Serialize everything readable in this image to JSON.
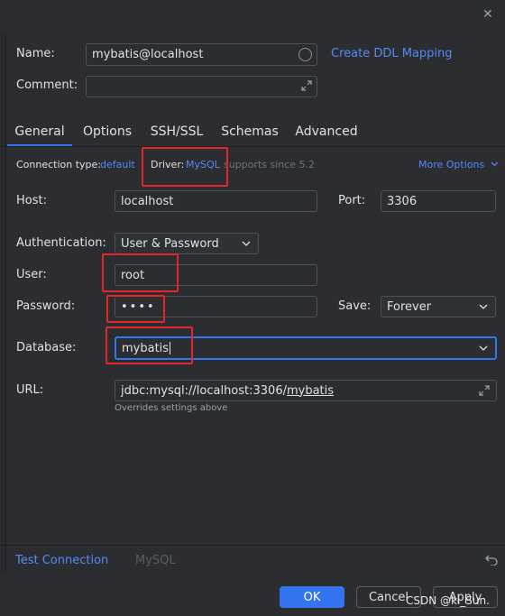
{
  "window": {
    "close_glyph": "✕"
  },
  "name": {
    "label": "Name:",
    "value": "mybatis@localhost",
    "create_ddl": "Create DDL Mapping"
  },
  "comment": {
    "label": "Comment:",
    "value": ""
  },
  "tabs": [
    {
      "label": "General"
    },
    {
      "label": "Options"
    },
    {
      "label": "SSH/SSL"
    },
    {
      "label": "Schemas"
    },
    {
      "label": "Advanced"
    }
  ],
  "connection": {
    "type_label": "Connection type:",
    "type_value": "default",
    "driver_label": "Driver:",
    "driver_value": "MySQL",
    "driver_note": "supports since 5.2",
    "more_options": "More Options"
  },
  "host": {
    "label": "Host:",
    "value": "localhost",
    "port_label": "Port:",
    "port_value": "3306"
  },
  "auth": {
    "label": "Authentication:",
    "value": "User & Password"
  },
  "user": {
    "label": "User:",
    "value": "root"
  },
  "password": {
    "label": "Password:",
    "value": "••••",
    "save_label": "Save:",
    "save_value": "Forever"
  },
  "database": {
    "label": "Database:",
    "value": "mybatis"
  },
  "url": {
    "label": "URL:",
    "prefix": "jdbc:mysql://localhost:3306/",
    "db": "mybatis",
    "note": "Overrides settings above"
  },
  "footer": {
    "test_connection": "Test Connection",
    "driver_name": "MySQL",
    "ok": "OK",
    "cancel": "Cancel",
    "apply": "Apply",
    "watermark": "CSDN @ki_Sun."
  },
  "colors": {
    "accent": "#3574f0",
    "link": "#548af7",
    "highlight": "#e3262a"
  }
}
